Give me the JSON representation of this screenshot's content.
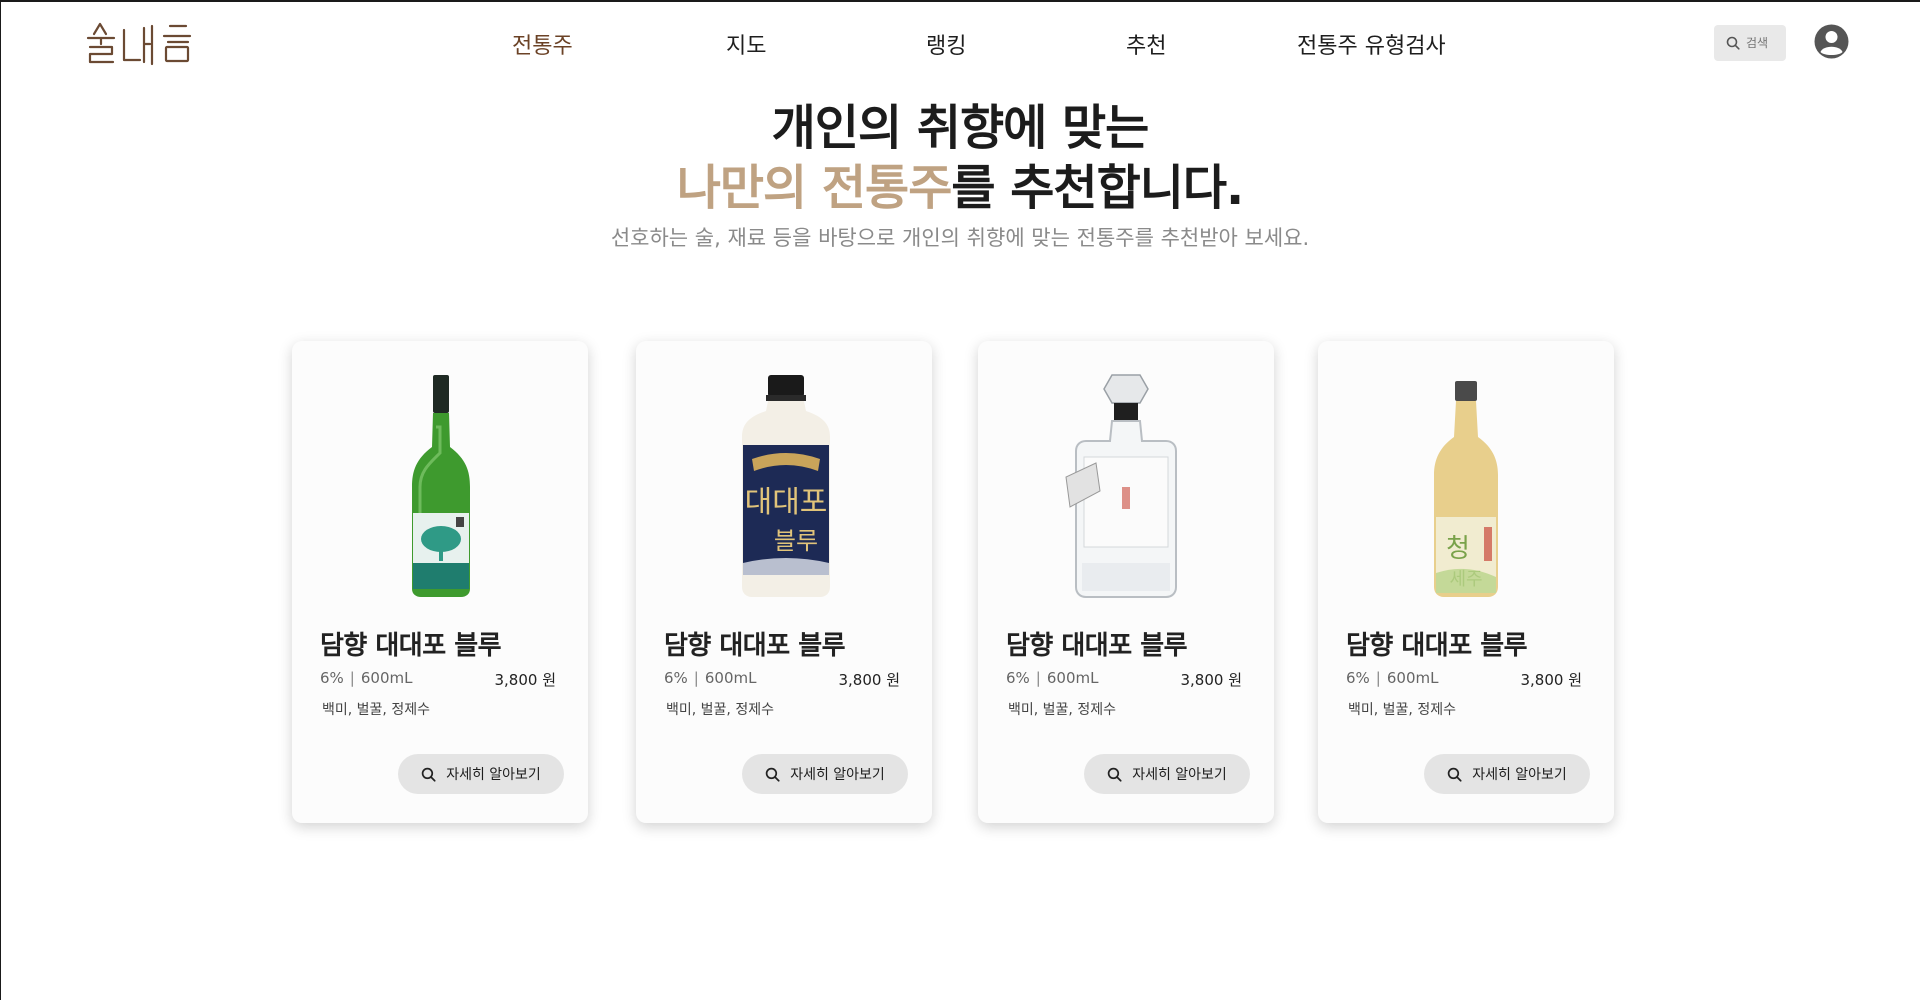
{
  "header": {
    "logo_text": "술내음",
    "nav": [
      {
        "label": "전통주",
        "active": true
      },
      {
        "label": "지도",
        "active": false
      },
      {
        "label": "랭킹",
        "active": false
      },
      {
        "label": "추천",
        "active": false
      },
      {
        "label": "전통주 유형검사",
        "active": false
      }
    ],
    "search": {
      "placeholder": "검색",
      "icon": "search-icon"
    },
    "profile_icon": "user-avatar-icon"
  },
  "hero": {
    "line1": "개인의 취향에 맞는",
    "line2_accent": "나만의 전통주",
    "line2_rest": "를 추천합니다.",
    "subtitle": "선호하는 술, 재료 등을 바탕으로  개인의 취향에 맞는 전통주를 추천받아 보세요."
  },
  "colors": {
    "accent": "#bfa282",
    "nav_active": "#6b4226",
    "button_bg": "#e4e4e4"
  },
  "cards": [
    {
      "name": "담향 대대포 블루",
      "abv": "6%",
      "volume": "600mL",
      "price": "3,800 원",
      "ingredients": "백미, 벌꿀, 정제수",
      "button": "자세히 알아보기",
      "bottle": "green-bottle"
    },
    {
      "name": "담향 대대포 블루",
      "abv": "6%",
      "volume": "600mL",
      "price": "3,800 원",
      "ingredients": "백미, 벌꿀, 정제수",
      "button": "자세히 알아보기",
      "bottle": "makgeolli-bottle"
    },
    {
      "name": "담향 대대포 블루",
      "abv": "6%",
      "volume": "600mL",
      "price": "3,800 원",
      "ingredients": "백미, 벌꿀, 정제수",
      "button": "자세히 알아보기",
      "bottle": "clear-square-bottle"
    },
    {
      "name": "담향 대대포 블루",
      "abv": "6%",
      "volume": "600mL",
      "price": "3,800 원",
      "ingredients": "백미, 벌꿀, 정제수",
      "button": "자세히 알아보기",
      "bottle": "golden-bottle"
    }
  ]
}
